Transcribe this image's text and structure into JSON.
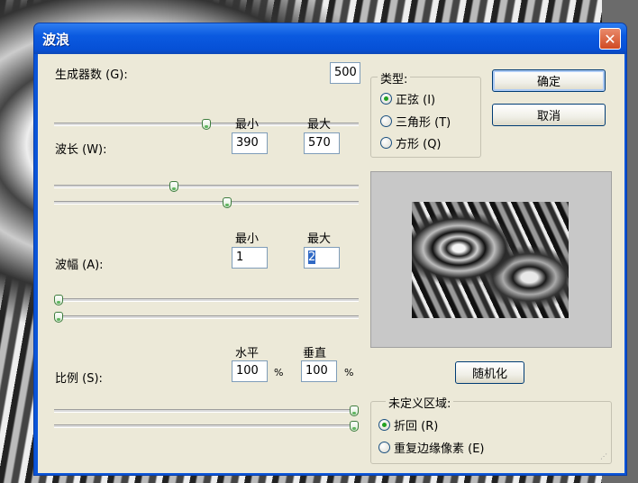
{
  "dialog": {
    "title": "波浪",
    "close_glyph": "✕"
  },
  "generators": {
    "label": "生成器数 (G):",
    "value": "500",
    "slider_fraction": 0.5
  },
  "wavelength": {
    "label": "波长 (W):",
    "min_header": "最小",
    "max_header": "最大",
    "min_value": "390",
    "max_value": "570",
    "min_slider_fraction": 0.39,
    "max_slider_fraction": 0.57
  },
  "amplitude": {
    "label": "波幅 (A):",
    "min_header": "最小",
    "max_header": "最大",
    "min_value": "1",
    "max_value": "2",
    "min_slider_fraction": 0.0,
    "max_slider_fraction": 0.0
  },
  "scale": {
    "label": "比例 (S):",
    "horizontal_header": "水平",
    "vertical_header": "垂直",
    "horizontal_value": "100",
    "vertical_value": "100",
    "percent_sign": "%",
    "horizontal_slider_fraction": 1.0,
    "vertical_slider_fraction": 1.0
  },
  "type_group": {
    "legend": "类型:",
    "options": [
      {
        "label": "正弦 (I)",
        "selected": true
      },
      {
        "label": "三角形 (T)",
        "selected": false
      },
      {
        "label": "方形 (Q)",
        "selected": false
      }
    ]
  },
  "buttons": {
    "ok": "确定",
    "cancel": "取消",
    "randomize": "随机化"
  },
  "undefined_area": {
    "legend": "未定义区域:",
    "options": [
      {
        "label": "折回 (R)",
        "selected": true
      },
      {
        "label": "重复边缘像素 (E)",
        "selected": false
      }
    ]
  },
  "colors": {
    "titlebar": "#0650d6",
    "dialog_bg": "#ece9d8",
    "selection": "#316ac5",
    "radio_dot": "#21a121"
  }
}
